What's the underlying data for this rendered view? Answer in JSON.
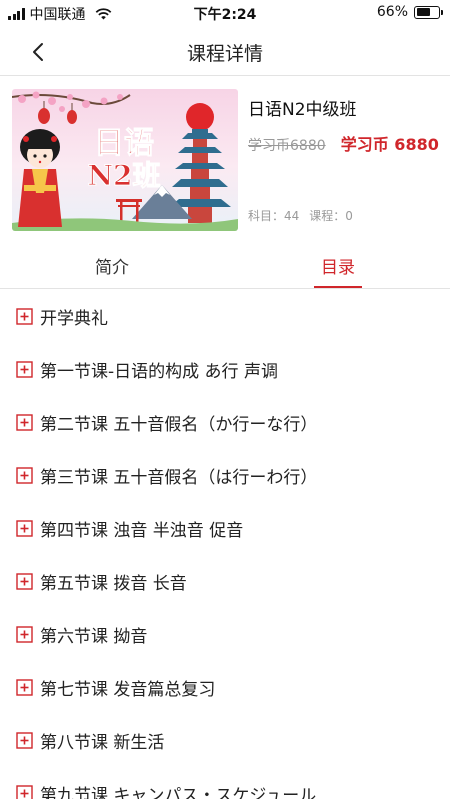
{
  "status_bar": {
    "carrier": "中国联通",
    "time": "下午2:24",
    "battery": "66%",
    "battery_level": 0.66
  },
  "nav": {
    "back_icon": "chevron-left-icon",
    "title": "课程详情"
  },
  "course": {
    "cover_text_line1": "日语",
    "cover_text_line2": "N2班",
    "title": "日语N2中级班",
    "price_original": "学习币6880",
    "price_current": "学习币 6880",
    "subjects_label": "科目：44",
    "lessons_label": "课程：0"
  },
  "tabs": {
    "intro": "简介",
    "catalog": "目录",
    "active": "catalog"
  },
  "colors": {
    "accent": "#d0262b",
    "muted": "#9a9a9a"
  },
  "lessons": [
    {
      "label": "开学典礼"
    },
    {
      "label": "第一节课-日语的构成 あ行  声调"
    },
    {
      "label": "第二节课 五十音假名（か行ーな行）"
    },
    {
      "label": "第三节课 五十音假名（は行ーわ行）"
    },
    {
      "label": "第四节课 浊音 半浊音 促音"
    },
    {
      "label": "第五节课 拨音  长音"
    },
    {
      "label": "第六节课 拗音"
    },
    {
      "label": "第七节课 发音篇总复习"
    },
    {
      "label": "第八节课 新生活"
    },
    {
      "label": "第九节课 キャンパス・スケジュール"
    }
  ]
}
